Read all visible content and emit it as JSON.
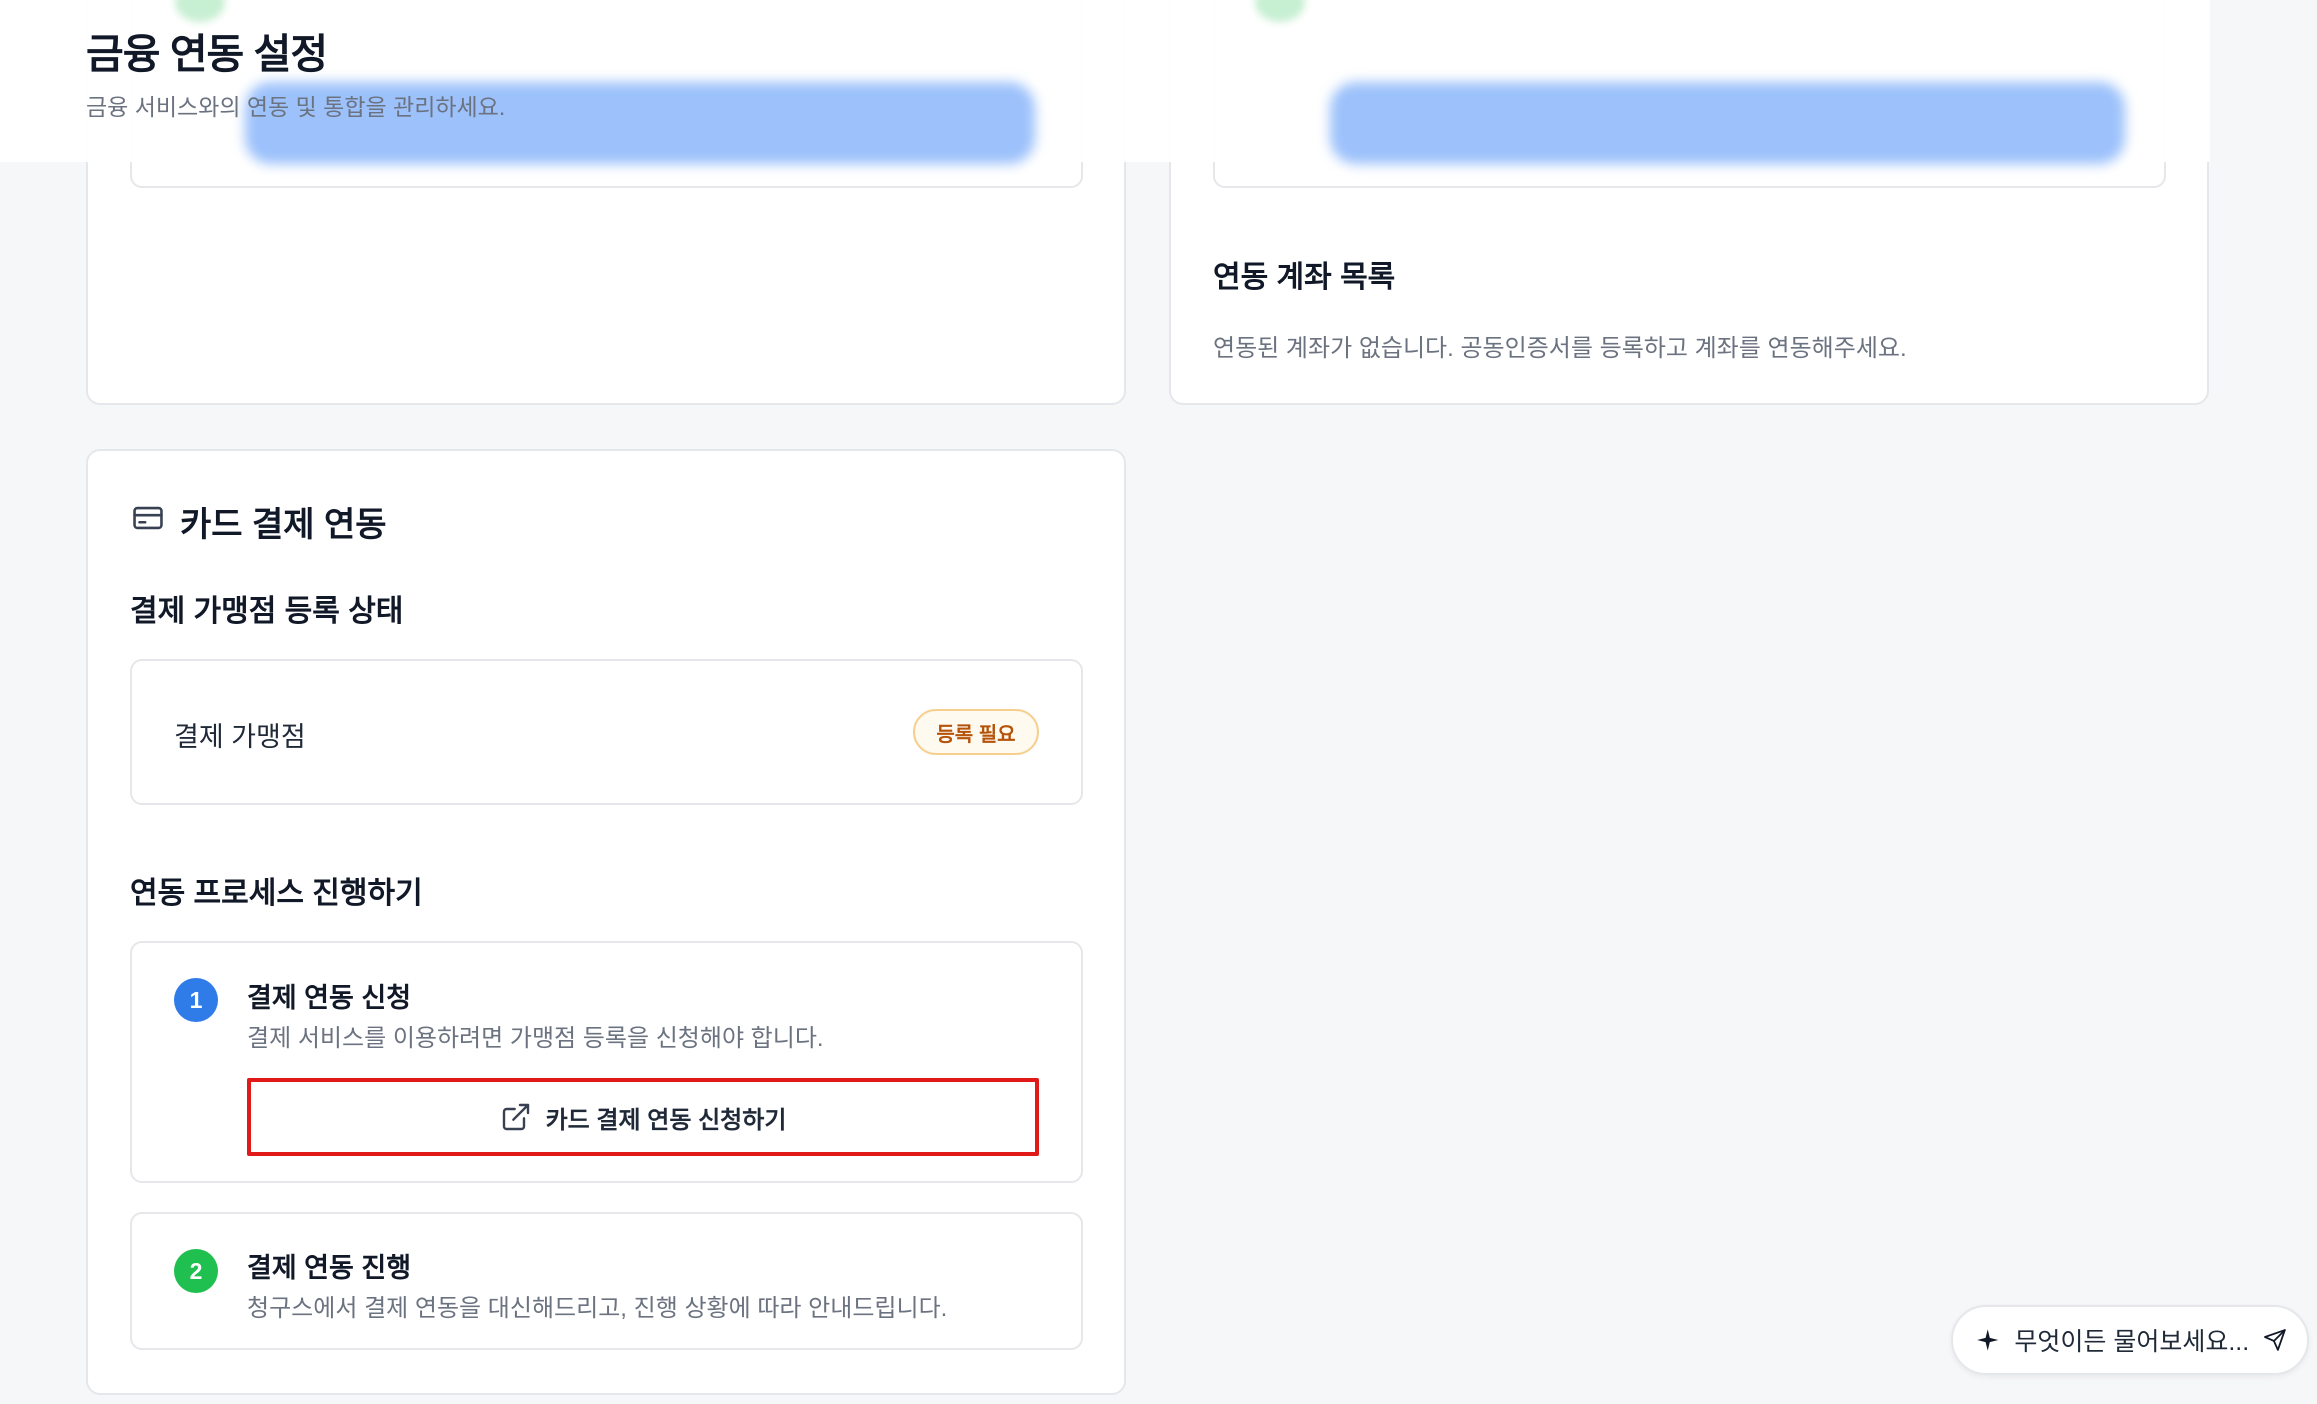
{
  "header": {
    "title": "금융 연동 설정",
    "subtitle": "금융 서비스와의 연동 및 통합을 관리하세요."
  },
  "account_list": {
    "title": "연동 계좌 목록",
    "empty_message": "연동된 계좌가 없습니다. 공동인증서를 등록하고 계좌를 연동해주세요."
  },
  "card_payment": {
    "title": "카드 결제 연동",
    "icon": "credit-card-icon",
    "merchant_status_title": "결제 가맹점 등록 상태",
    "merchant_label": "결제 가맹점",
    "merchant_badge": "등록 필요",
    "process_title": "연동 프로세스 진행하기",
    "steps": [
      {
        "number": "1",
        "title": "결제 연동 신청",
        "description": "결제 서비스를 이용하려면 가맹점 등록을 신청해야 합니다.",
        "color": "#2f7ce8"
      },
      {
        "number": "2",
        "title": "결제 연동 진행",
        "description": "청구스에서 결제 연동을 대신해드리고, 진행 상황에 따라 안내드립니다.",
        "color": "#1fbf50"
      }
    ],
    "apply_button": "카드 결제 연동 신청하기"
  },
  "assistant": {
    "placeholder": "무엇이든 물어보세요..."
  }
}
